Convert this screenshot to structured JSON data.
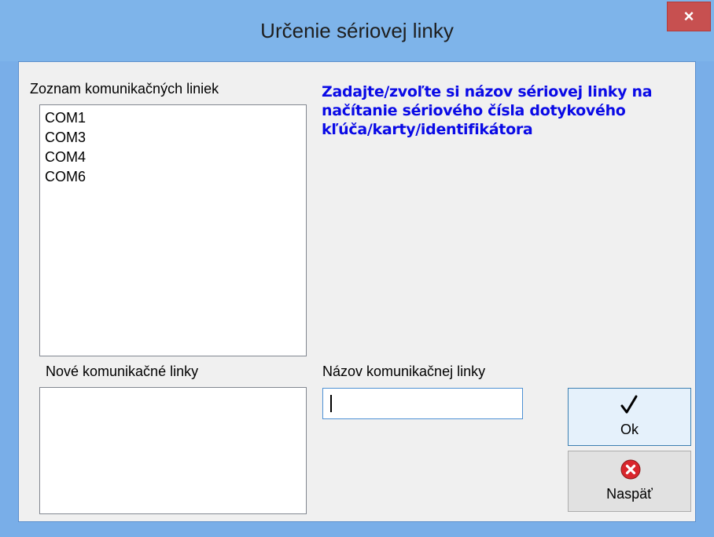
{
  "window": {
    "title": "Určenie sériovej linky",
    "close_label": "×"
  },
  "ports_list": {
    "label": "Zoznam komunikačných liniek",
    "items": [
      "COM1",
      "COM3",
      "COM4",
      "COM6"
    ]
  },
  "new_list": {
    "label": "Nové komunikačné linky",
    "items": []
  },
  "instruction": {
    "line1": "Zadajte/zvoľte si názov sériovej linky na",
    "line2": "načítanie sériového čísla dotykového",
    "line3": "kľúča/karty/identifikátora"
  },
  "name_field": {
    "label": "Názov komunikačnej linky",
    "value": ""
  },
  "buttons": {
    "ok_label": "Ok",
    "back_label": "Naspäť"
  },
  "colors": {
    "instruction_text": "#0a0ae6",
    "titlebar": "#7eb4ea",
    "close_button": "#c75050",
    "error_icon": "#d9262c"
  },
  "icons": {
    "ok": "checkmark-icon",
    "back": "error-x-icon"
  }
}
